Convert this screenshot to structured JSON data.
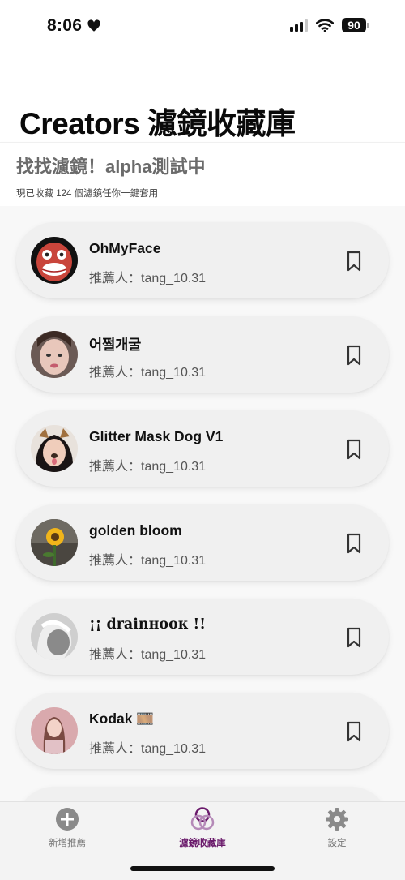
{
  "status_bar": {
    "time": "8:06",
    "battery": "90"
  },
  "page": {
    "title": "Creators 濾鏡收藏庫"
  },
  "subheader": {
    "title": "找找濾鏡！alpha測試中",
    "caption": "現已收藏 124 個濾鏡任你一鍵套用"
  },
  "filters": [
    {
      "name": "OhMyFace",
      "recommender": "推薦人：tang_10.31"
    },
    {
      "name": "어쩔개굴",
      "recommender": "推薦人：tang_10.31"
    },
    {
      "name": "Glitter Mask Dog V1",
      "recommender": "推薦人：tang_10.31"
    },
    {
      "name": "golden bloom",
      "recommender": "推薦人：tang_10.31"
    },
    {
      "name": "¡¡ drainʜᴏᴏᴋ !!",
      "recommender": "推薦人：tang_10.31"
    },
    {
      "name": "Kodak 🎞️",
      "recommender": "推薦人：tang_10.31"
    }
  ],
  "tab_bar": {
    "tabs": [
      {
        "label": "新增推薦",
        "icon": "plus-circle-icon"
      },
      {
        "label": "濾鏡收藏庫",
        "icon": "interlocking-circles-icon",
        "active": true
      },
      {
        "label": "設定",
        "icon": "gear-icon"
      }
    ]
  },
  "colors": {
    "accent": "#6a1a6b",
    "card_bg": "#f0f0f0",
    "list_bg": "#f8f8f8"
  }
}
